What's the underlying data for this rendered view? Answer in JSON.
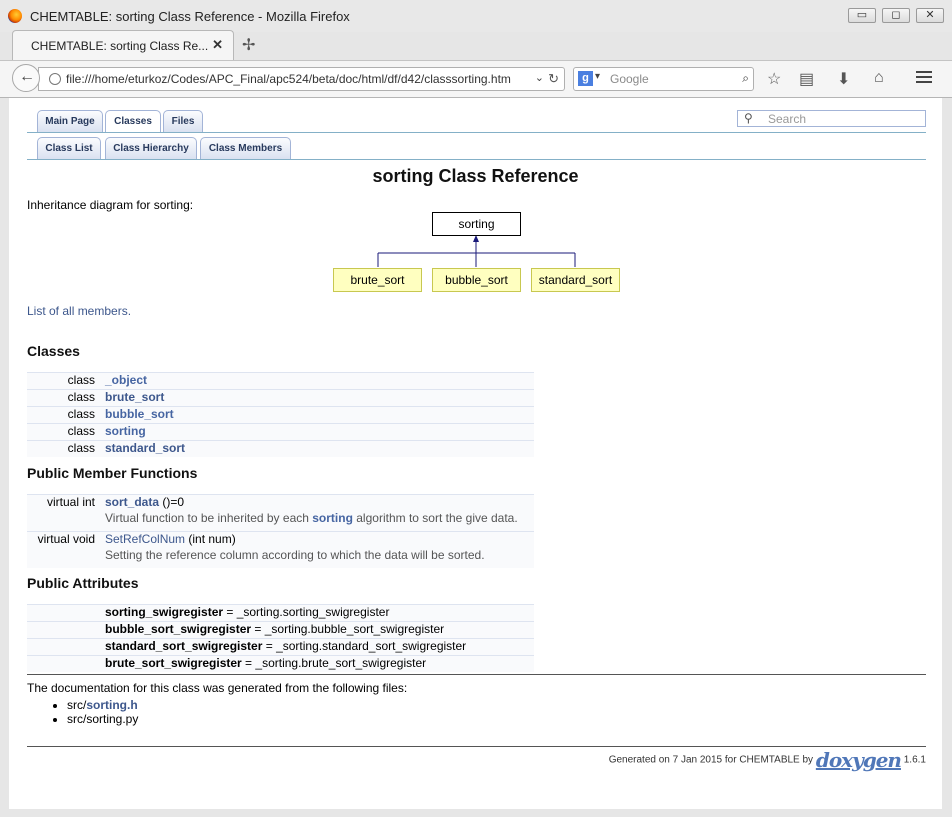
{
  "window": {
    "title": "CHEMTABLE: sorting Class Reference - Mozilla Firefox",
    "buttons": {
      "minimize": "▭",
      "maximize": "◻",
      "close": "✕"
    }
  },
  "tabs": [
    {
      "label": "CHEMTABLE: sorting Class Re...",
      "close": "✕"
    }
  ],
  "newtab": "✢",
  "nav": {
    "back": "←",
    "url": "file:///home/eturkoz/Codes/APC_Final/apc524/beta/doc/html/df/d42/classsorting.htm",
    "dropdown": "⌄",
    "reload": "↻",
    "search_engine": "g",
    "search_placeholder": "Google",
    "search_icon": "⌕",
    "bookmark_icon": "☆",
    "reader_icon": "▤",
    "download_icon": "⬇",
    "home_icon": "⌂"
  },
  "doxygen": {
    "tabs_row1": [
      "Main Page",
      "Classes",
      "Files"
    ],
    "tabs_row2": [
      "Class List",
      "Class Hierarchy",
      "Class Members"
    ],
    "search_placeholder": "Search",
    "title": "sorting Class Reference",
    "inheritance_label": "Inheritance diagram for sorting:",
    "diagram": {
      "parent": "sorting",
      "children": [
        "brute_sort",
        "bubble_sort",
        "standard_sort"
      ]
    },
    "all_members": "List of all members.",
    "classes_heading": "Classes",
    "classes": [
      {
        "kind": "class",
        "name": "_object"
      },
      {
        "kind": "class",
        "name": "brute_sort"
      },
      {
        "kind": "class",
        "name": "bubble_sort"
      },
      {
        "kind": "class",
        "name": "sorting"
      },
      {
        "kind": "class",
        "name": "standard_sort"
      }
    ],
    "functions_heading": "Public Member Functions",
    "functions": [
      {
        "type": "virtual int",
        "name": "sort_data",
        "args": " ()=0",
        "desc_pre": "Virtual function to be inherited by each ",
        "desc_link": "sorting",
        "desc_post": " algorithm to sort the give data."
      },
      {
        "type": "virtual void",
        "name": "SetRefColNum",
        "args": " (int num)",
        "desc_pre": "Setting the reference column according to which the data will be sorted.",
        "desc_link": "",
        "desc_post": ""
      }
    ],
    "attributes_heading": "Public Attributes",
    "attributes": [
      {
        "name": "sorting_swigregister",
        "value": " = _sorting.sorting_swigregister"
      },
      {
        "name": "bubble_sort_swigregister",
        "value": " = _sorting.bubble_sort_swigregister"
      },
      {
        "name": "standard_sort_swigregister",
        "value": " = _sorting.standard_sort_swigregister"
      },
      {
        "name": "brute_sort_swigregister",
        "value": " = _sorting.brute_sort_swigregister"
      }
    ],
    "files_intro": "The documentation for this class was generated from the following files:",
    "files": [
      {
        "prefix": "src/",
        "link": "sorting.h"
      },
      {
        "prefix": "src/sorting.py",
        "link": ""
      }
    ],
    "footer_text": "Generated on 7 Jan 2015 for CHEMTABLE by",
    "footer_logo": "doxygen",
    "footer_version": "1.6.1"
  }
}
